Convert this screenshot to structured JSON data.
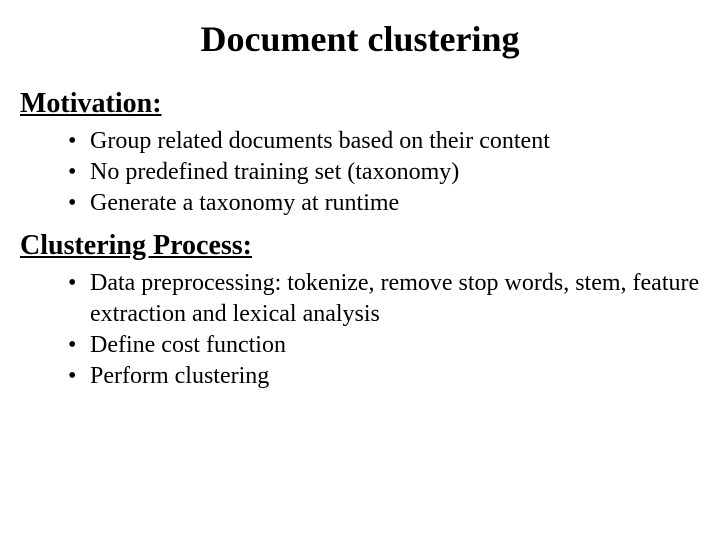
{
  "title": "Document clustering",
  "sections": [
    {
      "heading": "Motivation:",
      "bullets": [
        "Group related documents based on their content",
        "No predefined training set (taxonomy)",
        "Generate a taxonomy at runtime"
      ]
    },
    {
      "heading": "Clustering Process:",
      "bullets": [
        "Data preprocessing: tokenize, remove stop words, stem, feature extraction and lexical analysis",
        "Define cost function",
        "Perform clustering"
      ]
    }
  ]
}
